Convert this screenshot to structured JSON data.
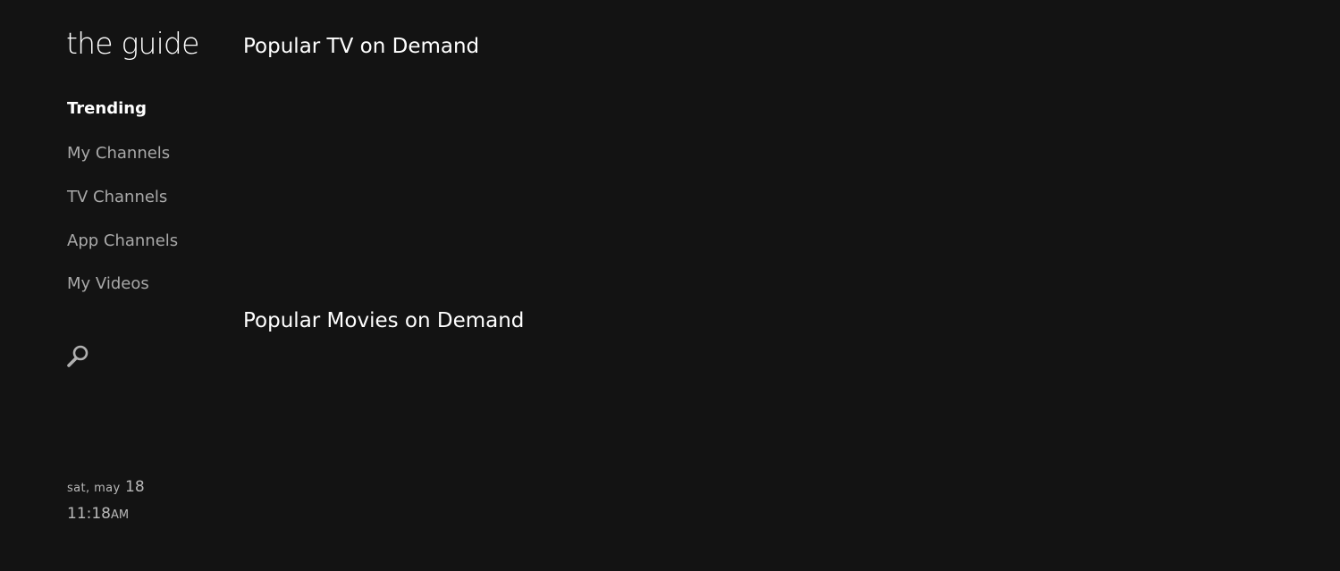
{
  "app": {
    "title": "the guide"
  },
  "nav": {
    "items": [
      {
        "label": "Trending",
        "active": true
      },
      {
        "label": "My Channels",
        "active": false
      },
      {
        "label": "TV Channels",
        "active": false
      },
      {
        "label": "App Channels",
        "active": false
      },
      {
        "label": "My Videos",
        "active": false
      }
    ],
    "search_icon": "search-icon"
  },
  "clock": {
    "day_month": "sat, may",
    "day": "18",
    "time": "11:18",
    "ampm": "AM"
  },
  "sections": [
    {
      "title": "Popular TV on Demand"
    },
    {
      "title": "Popular Movies on Demand"
    }
  ],
  "colors": {
    "background": "#131313",
    "text_primary": "#ffffff",
    "text_secondary": "#a9a9a9"
  }
}
